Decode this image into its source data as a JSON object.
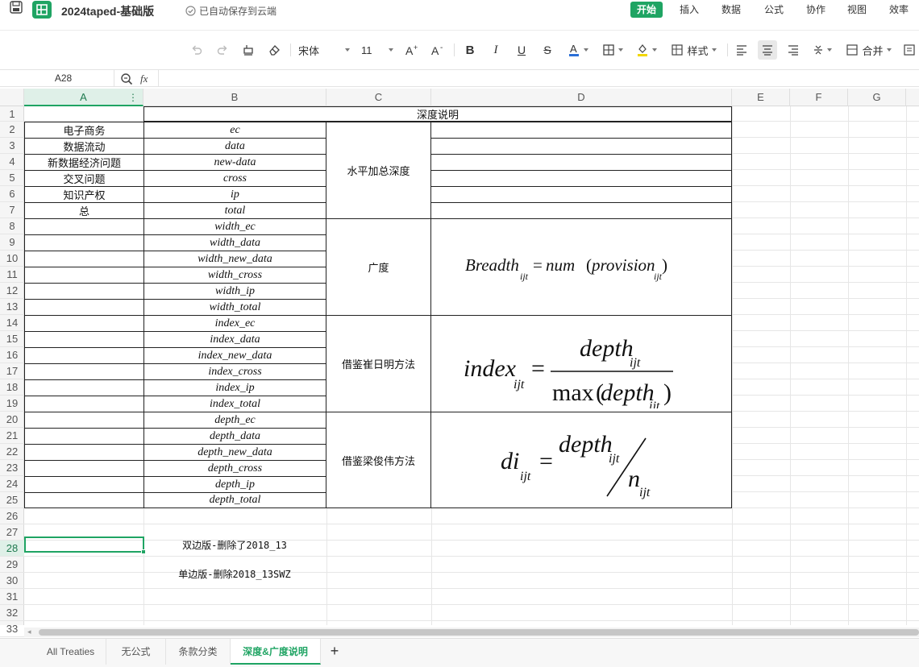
{
  "titlebar": {
    "title": "2024taped-基础版",
    "saved_status": "已自动保存到云端",
    "menus": [
      "开始",
      "插入",
      "数据",
      "公式",
      "协作",
      "视图",
      "效率"
    ],
    "active_menu": "开始"
  },
  "toolbar": {
    "font_name": "宋体",
    "font_size": "11",
    "style_label": "样式",
    "merge_label": "合并"
  },
  "formulabar": {
    "cell_ref": "A28",
    "fx_label": "fx",
    "value": ""
  },
  "columns": [
    "A",
    "B",
    "C",
    "D",
    "E",
    "F",
    "G"
  ],
  "rows": [
    "1",
    "2",
    "3",
    "4",
    "5",
    "6",
    "7",
    "8",
    "9",
    "10",
    "11",
    "12",
    "13",
    "14",
    "15",
    "16",
    "17",
    "18",
    "19",
    "20",
    "21",
    "22",
    "23",
    "24",
    "25",
    "26",
    "27",
    "28",
    "29",
    "30",
    "31",
    "32",
    "33"
  ],
  "cells": {
    "header_merged": "深度说明",
    "a_labels": [
      "电子商务",
      "数据流动",
      "新数据经济问题",
      "交叉问题",
      "知识产权",
      "总"
    ],
    "b_values": [
      "ec",
      "data",
      "new-data",
      "cross",
      "ip",
      "total",
      "width_ec",
      "width_data",
      "width_new_data",
      "width_cross",
      "width_ip",
      "width_total",
      "index_ec",
      "index_data",
      "index_new_data",
      "index_cross",
      "index_ip",
      "index_total",
      "depth_ec",
      "depth_data",
      "depth_new_data",
      "depth_cross",
      "depth_ip",
      "depth_total"
    ],
    "c_groups": [
      "水平加总深度",
      "广度",
      "借鉴崔日明方法",
      "借鉴梁俊伟方法"
    ],
    "note_28": "双边版-删除了2018_13",
    "note_30": "单边版-删除2018_13SWZ"
  },
  "formulas": {
    "breadth": {
      "lhs": "Breadth",
      "sub": "ijt",
      "eq": "=",
      "f": "num",
      "arg": "provision",
      "arg_sub": "ijt"
    },
    "index": {
      "lhs": "index",
      "sub": "ijt",
      "num": "depth",
      "num_sub": "ijt",
      "den_fn": "max",
      "den": "depth",
      "den_sub": "ijt"
    },
    "di": {
      "lhs": "di",
      "sub": "ijt",
      "num": "depth",
      "num_sub": "ijt",
      "den": "n",
      "den_sub": "ijt"
    }
  },
  "sheet_tabs": [
    "All Treaties",
    "无公式",
    "条款分类",
    "深度&广度说明"
  ],
  "active_tab": "深度&广度说明",
  "colors": {
    "accent": "#1fa463",
    "grid": "#e6e6e6",
    "border": "#222222"
  }
}
